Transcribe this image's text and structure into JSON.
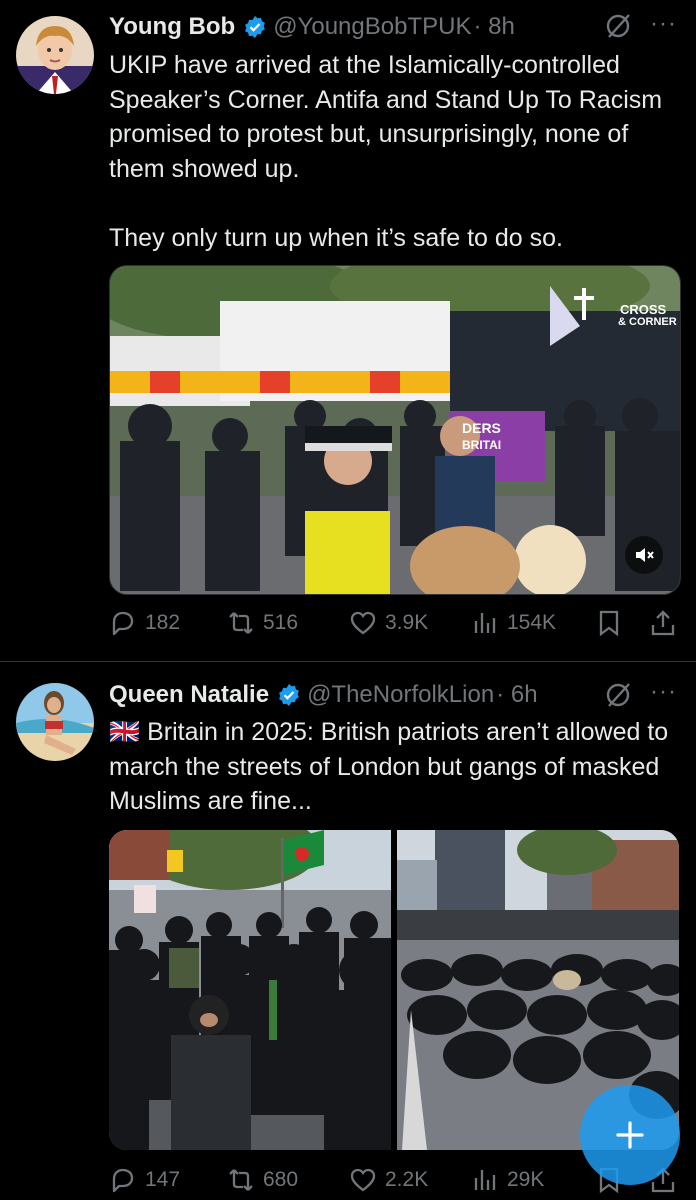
{
  "tweets": [
    {
      "name": "Young Bob",
      "handle": "@YoungBobTPUK",
      "time": "· 8h",
      "text": "UKIP have arrived at the Islamically-controlled Speaker’s Corner. Antifa and Stand Up To Racism promised to protest but, unsurprisingly, none of them showed up.\n\nThey only turn up when it’s safe to do so.",
      "media": {
        "overlay_brand_top": "CROSS",
        "overlay_brand_bottom": "& CORNER",
        "banner_line1": "DERS",
        "banner_line2": "BRITAI"
      },
      "stats": {
        "replies": "182",
        "reposts": "516",
        "likes": "3.9K",
        "views": "154K"
      }
    },
    {
      "name": "Queen Natalie",
      "handle": "@TheNorfolkLion",
      "time": "· 6h",
      "text": "🇬🇧 Britain in 2025: British patriots aren’t allowed to march the streets of London but gangs of masked Muslims are fine...",
      "stats": {
        "replies": "147",
        "reposts": "680",
        "likes": "2.2K",
        "views": "29K"
      }
    }
  ],
  "colors": {
    "background": "#000000",
    "text": "#e7e9ea",
    "muted": "#71767b",
    "verified": "#1d9bf0",
    "divider": "#2f3336"
  },
  "fab": {
    "icon": "plus-icon"
  }
}
